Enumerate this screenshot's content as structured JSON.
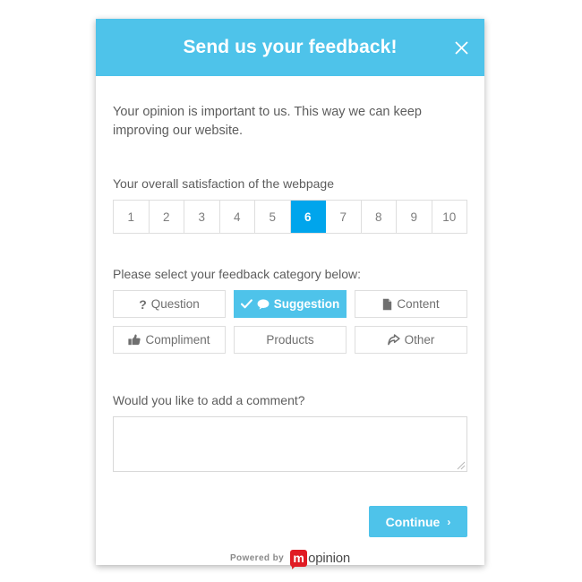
{
  "modal": {
    "title": "Send us your feedback!",
    "close_icon": "close-icon",
    "intro": "Your opinion is important to us. This way we can keep improving our website."
  },
  "rating": {
    "label": "Your overall satisfaction of the webpage",
    "options": [
      "1",
      "2",
      "3",
      "4",
      "5",
      "6",
      "7",
      "8",
      "9",
      "10"
    ],
    "selected": "6",
    "selected_color": "#00a5ec"
  },
  "category": {
    "label": "Please select your feedback category below:",
    "selected": "Suggestion",
    "selected_color": "#4ec3ea",
    "options": [
      {
        "label": "Question",
        "icon": "question-mark-icon",
        "selected": false
      },
      {
        "label": "Suggestion",
        "icon": "speech-bubble-icon",
        "selected": true
      },
      {
        "label": "Content",
        "icon": "document-icon",
        "selected": false
      },
      {
        "label": "Compliment",
        "icon": "thumbs-up-icon",
        "selected": false
      },
      {
        "label": "Products",
        "icon": "",
        "selected": false
      },
      {
        "label": "Other",
        "icon": "share-arrow-icon",
        "selected": false
      }
    ]
  },
  "comment": {
    "label": "Would you like to add a comment?",
    "value": "",
    "placeholder": ""
  },
  "actions": {
    "continue_label": "Continue",
    "chevron": "›"
  },
  "footer": {
    "powered_by": "Powered by",
    "logo_mark": "m",
    "logo_word": "opinion",
    "logo_color": "#e01b24"
  }
}
